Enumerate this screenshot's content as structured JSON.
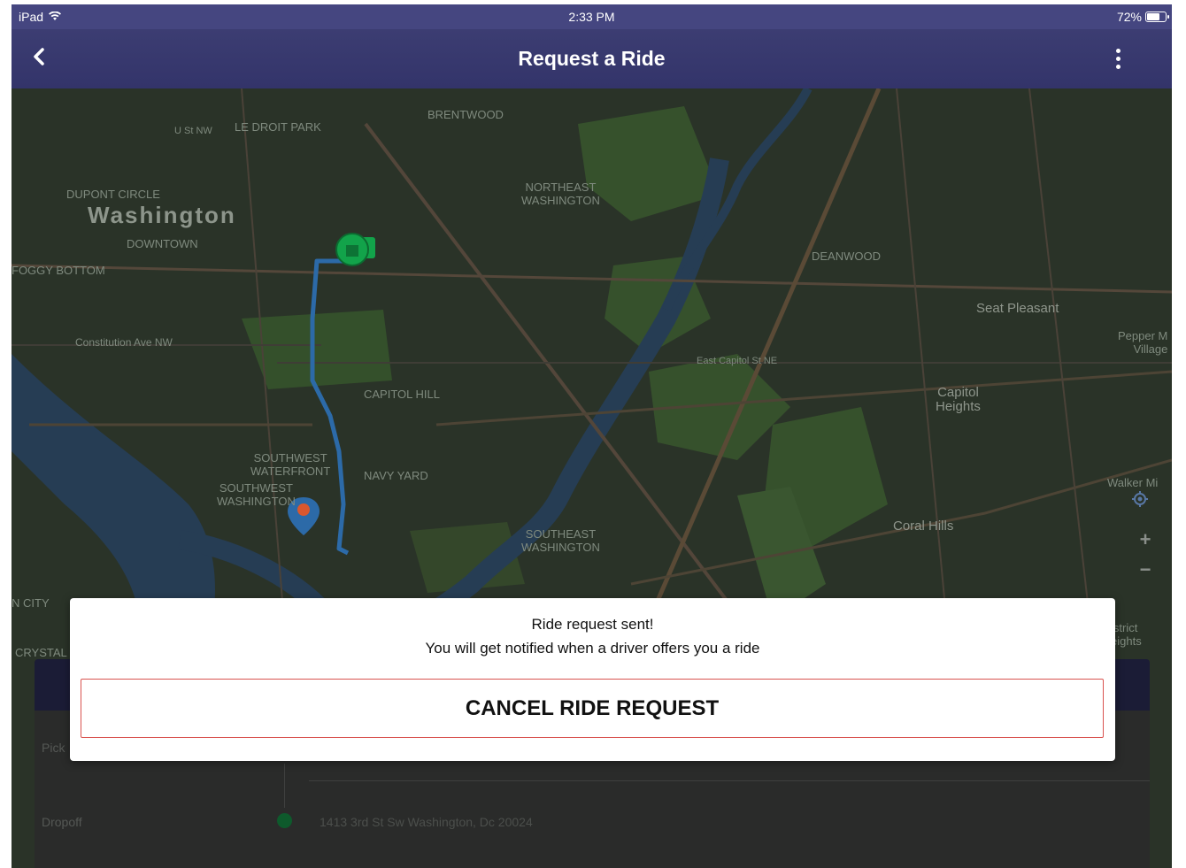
{
  "status_bar": {
    "device": "iPad",
    "time": "2:33 PM",
    "battery": "72%",
    "battery_level": 0.72,
    "wifi_icon": "wifi-icon"
  },
  "nav": {
    "title": "Request a Ride",
    "back_icon": "chevron-left-icon",
    "more_icon": "more-vertical-icon"
  },
  "map": {
    "labels": {
      "le_droit_park": "LE DROIT PARK",
      "brentwood": "BRENTWOOD",
      "u_st": "U St NW",
      "dupont": "DUPONT CIRCLE",
      "washington": "Washington",
      "downtown": "DOWNTOWN",
      "foggy": "FOGGY BOTTOM",
      "constitution": "Constitution Ave NW",
      "northeast": "NORTHEAST\nWASHINGTON",
      "deanwood": "DEANWOOD",
      "seat_pleasant": "Seat Pleasant",
      "pepper_mill": "Pepper M\nVillage",
      "capitol_hill": "CAPITOL HILL",
      "capitol_heights": "Capitol\nHeights",
      "east_capitol": "East Capitol St NE",
      "sw_waterfront": "SOUTHWEST\nWATERFRONT",
      "sw_washington": "SOUTHWEST\nWASHINGTON",
      "navy_yard": "NAVY YARD",
      "se_washington": "SOUTHEAST\nWASHINGTON",
      "coral_hills": "Coral Hills",
      "walker_mill": "Walker Mi",
      "crystal": "CRYSTAL",
      "n_city": "N CITY",
      "district_heights": "istrict\neights"
    },
    "controls": {
      "locate_icon": "locate-icon",
      "zoom_in": "+",
      "zoom_out": "−"
    }
  },
  "card": {
    "pickup_label": "Pick",
    "dropoff_label": "Dropoff",
    "dropoff_address": "1413 3rd St Sw Washington, Dc 20024"
  },
  "modal": {
    "title": "Ride request sent!",
    "message": "You will get notified when a driver offers you a ride",
    "cancel_label": "CANCEL RIDE REQUEST"
  },
  "colors": {
    "nav_bar": "#3c3d72",
    "status_bar": "#454680",
    "cancel_border": "#d9534f",
    "route": "#2c6aa8",
    "pickup_marker": "#12a34a"
  }
}
